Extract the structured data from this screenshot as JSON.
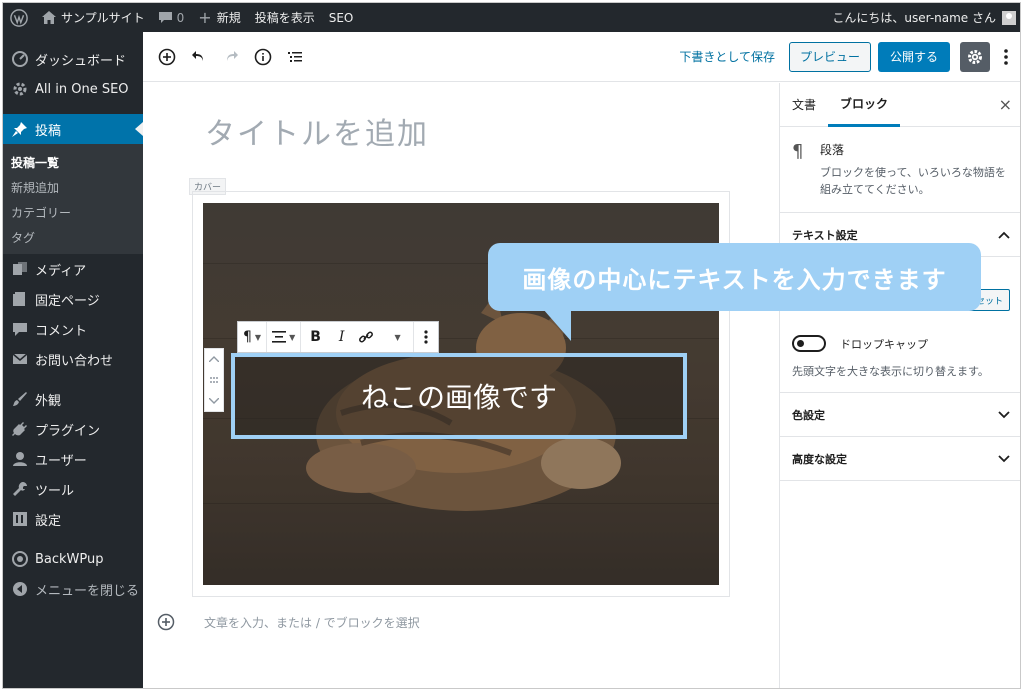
{
  "adminbar": {
    "site_name": "サンプルサイト",
    "comments_count": "0",
    "new_label": "新規",
    "view_post": "投稿を表示",
    "seo": "SEO",
    "greeting": "こんにちは、user-name さん"
  },
  "sidebar": {
    "items": [
      {
        "label": "ダッシュボード",
        "icon": "dashboard-icon"
      },
      {
        "label": "All in One SEO",
        "icon": "gear-icon"
      },
      {
        "label": "投稿",
        "icon": "pin-icon"
      },
      {
        "label": "メディア",
        "icon": "media-icon"
      },
      {
        "label": "固定ページ",
        "icon": "page-icon"
      },
      {
        "label": "コメント",
        "icon": "comment-icon"
      },
      {
        "label": "お問い合わせ",
        "icon": "mail-icon"
      },
      {
        "label": "外観",
        "icon": "brush-icon"
      },
      {
        "label": "プラグイン",
        "icon": "plugin-icon"
      },
      {
        "label": "ユーザー",
        "icon": "user-icon"
      },
      {
        "label": "ツール",
        "icon": "wrench-icon"
      },
      {
        "label": "設定",
        "icon": "settings-icon"
      },
      {
        "label": "BackWPup",
        "icon": "backwpup-icon"
      },
      {
        "label": "メニューを閉じる",
        "icon": "collapse-icon"
      }
    ],
    "submenu": [
      "投稿一覧",
      "新規追加",
      "カテゴリー",
      "タグ"
    ]
  },
  "toolbar": {
    "save_draft": "下書きとして保存",
    "preview": "プレビュー",
    "publish": "公開する"
  },
  "editor": {
    "title_placeholder": "タイトルを追加",
    "block_label": "カバー",
    "cover_text": "ねこの画像です",
    "append_placeholder": "文章を入力、または / でブロックを選択"
  },
  "panel": {
    "tab_document": "文書",
    "tab_block": "ブロック",
    "close": "×",
    "block_name": "段落",
    "block_desc": "ブロックを使って、いろいろな物語を組み立ててください。",
    "text_settings": "テキスト設定",
    "reset": "リセット",
    "drop_cap": "ドロップキャップ",
    "drop_cap_help": "先頭文字を大きな表示に切り替えます。",
    "color_settings": "色設定",
    "advanced": "高度な設定"
  },
  "callout": {
    "text": "画像の中心にテキストを入力できます"
  },
  "colors": {
    "admin_dark": "#23282d",
    "accent": "#007cba",
    "callout": "#9fd0f5"
  }
}
